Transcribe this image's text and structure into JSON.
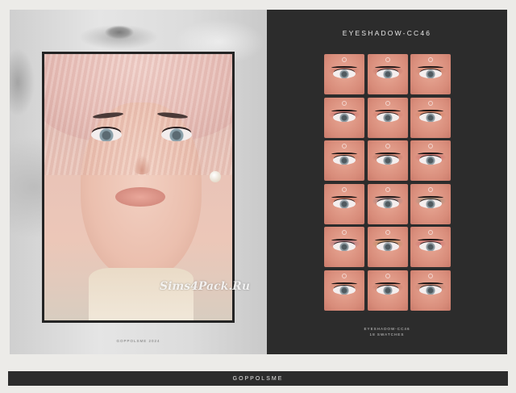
{
  "left": {
    "watermark": "Sims4Pack.Ru",
    "caption": "GOPPOLSME 2024"
  },
  "right": {
    "title": "EYESHADOW-CC46",
    "caption_line1": "EYESHADOW-CC46",
    "caption_line2": "18 SWATCHES",
    "swatch_colors": [
      "#b65a4f",
      "#a04c4a",
      "#b86b4f",
      "#b04a5a",
      "#c35e50",
      "#c66a3d",
      "#c46f53",
      "#8f4d3f",
      "#b64452",
      "#c85a3f",
      "#5a6f86",
      "#5a8a76",
      "#7c5a8f",
      "#8a8a3d",
      "#b3465e",
      "#c27a5f",
      "#a35e4b",
      "#9a6a5a"
    ]
  },
  "footer": {
    "brand": "GOPPOLSME"
  },
  "colors": {
    "page_bg": "#ecebe8",
    "dark_panel": "#2c2c2c",
    "frame": "#242424"
  }
}
